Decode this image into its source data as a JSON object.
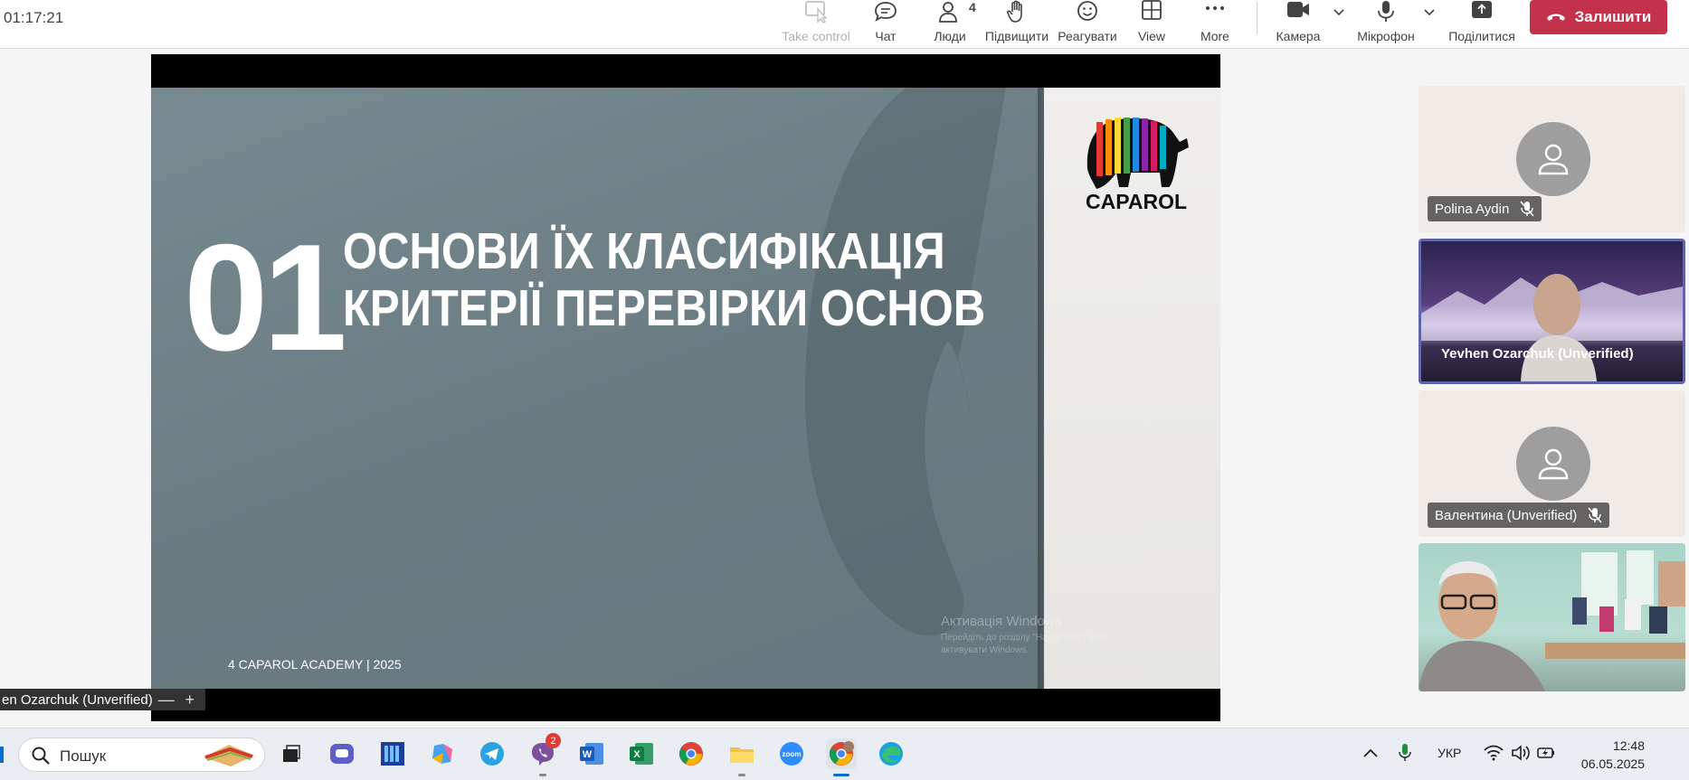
{
  "meeting": {
    "elapsed": "01:17:21"
  },
  "toolbar": {
    "take_control": "Take control",
    "chat": "Чат",
    "people": "Люди",
    "people_count": "4",
    "raise": "Підвищити",
    "react": "Реагувати",
    "view": "View",
    "more": "More",
    "camera": "Камера",
    "mic": "Мікрофон",
    "share": "Поділитися",
    "leave": "Залишити"
  },
  "slide": {
    "number": "01",
    "title_line1": "ОСНОВИ  ЇХ КЛАСИФІКАЦІЯ",
    "title_line2": "КРИТЕРІЇ ПЕРЕВІРКИ ОСНОВ",
    "footer": "4  CAPAROL ACADEMY | 2025",
    "logo_text": "CAPAROL",
    "watermark_title": "Активація Windows",
    "watermark_body": "Перейдіть до розділу \"Настройки\", щоб активувати Windows."
  },
  "presenter": {
    "label": "en Ozarchuk (Unverified)"
  },
  "participants": [
    {
      "name": "Polina Aydin",
      "muted": true
    },
    {
      "name": "Yevhen Ozarchuk (Unverified)",
      "video": true,
      "active": true
    },
    {
      "name": "Валентина (Unverified)",
      "muted": true
    },
    {
      "name": "",
      "video": true
    }
  ],
  "taskbar": {
    "search_placeholder": "Пошук",
    "viber_badge": "2",
    "zoom_label": "zoom",
    "language": "УКР",
    "time": "12:48",
    "date": "06.05.2025"
  },
  "colors": {
    "leave": "#c4314b",
    "active_tile_border": "#6264a7",
    "slide_gray": "#6f8087"
  }
}
